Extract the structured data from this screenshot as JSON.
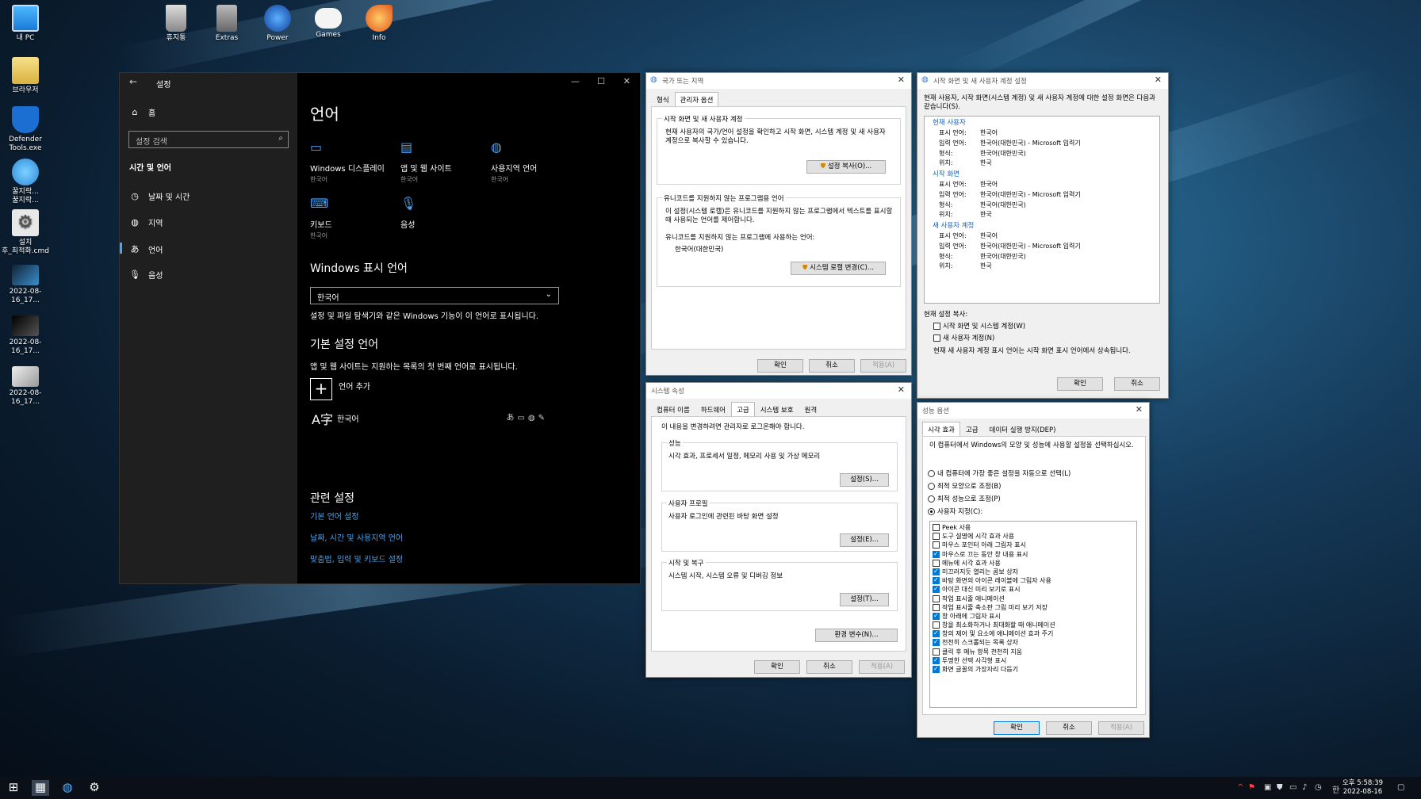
{
  "desktop_icons": [
    {
      "label": "내 PC",
      "icon": "monitor-icon"
    },
    {
      "label": "브라우저",
      "icon": "folder-icon"
    },
    {
      "label": "Defender Tools.exe",
      "icon": "shield-icon"
    },
    {
      "label": "꿀지락...\n꿀지락...",
      "icon": "ie-icon"
    },
    {
      "label": "설치\n후_최적화.cmd",
      "icon": "gear-icon"
    },
    {
      "label": "2022-08-16_17...",
      "icon": "image-icon"
    },
    {
      "label": "2022-08-16_17...",
      "icon": "image-icon"
    },
    {
      "label": "2022-08-16_17...",
      "icon": "image-icon"
    },
    {
      "label": "휴지통",
      "icon": "recycle-bin-icon"
    },
    {
      "label": "Extras",
      "icon": "folder-icon"
    },
    {
      "label": "Power",
      "icon": "power-icon"
    },
    {
      "label": "Games",
      "icon": "gamepad-icon"
    },
    {
      "label": "Info",
      "icon": "info-icon"
    }
  ],
  "settings": {
    "window_title": "설정",
    "home": "홈",
    "search_placeholder": "설정 검색",
    "section": "시간 및 언어",
    "nav": [
      "날짜 및 시간",
      "지역",
      "언어",
      "음성"
    ],
    "page_title": "언어",
    "tiles": [
      {
        "label": "Windows 디스플레이",
        "sub": "한국어"
      },
      {
        "label": "앱 및 웹 사이트",
        "sub": "한국어"
      },
      {
        "label": "사용지역 언어",
        "sub": "한국어"
      },
      {
        "label": "키보드",
        "sub": "한국어"
      },
      {
        "label": "음성",
        "sub": ""
      }
    ],
    "display_lang_heading": "Windows 표시 언어",
    "display_lang_value": "한국어",
    "display_lang_desc": "설정 및 파일 탐색기와 같은 Windows 기능이 이 언어로 표시됩니다.",
    "pref_heading": "기본 설정 언어",
    "pref_desc": "앱 및 웹 사이트는 지원하는 목록의 첫 번째 언어로 표시됩니다.",
    "add_lang": "언어 추가",
    "lang_item": "한국어",
    "related_heading": "관련 설정",
    "related_links": [
      "기본 언어 설정",
      "날짜, 시간 및 사용지역 언어",
      "맞춤법, 입력 및 키보드 설정"
    ]
  },
  "region_dialog": {
    "title": "국가 또는 지역",
    "tabs": [
      "형식",
      "관리자 옵션"
    ],
    "grp1_title": "시작 화면 및 새 사용자 계정",
    "grp1_text": "현재 사용자의 국가/언어 설정을 확인하고 시작 화면, 시스템 계정 및 새 사용자 계정으로 복사할 수 있습니다.",
    "grp1_button": "설정 복사(O)...",
    "grp2_title": "유니코드를 지원하지 않는 프로그램용 언어",
    "grp2_text": "이 설정(시스템 로캘)은 유니코드를 지원하지 않는 프로그램에서 텍스트를 표시할 때 사용되는 언어를 제어합니다.",
    "grp2_label": "유니코드를 지원하지 않는 프로그램에 사용하는 언어:",
    "grp2_value": "한국어(대한민국)",
    "grp2_button": "시스템 로캘 변경(C)...",
    "ok": "확인",
    "cancel": "취소",
    "apply": "적용(A)"
  },
  "welcome_dialog": {
    "title": "시작 화면 및 새 사용자 계정 설정",
    "intro": "현재 사용자, 시작 화면(시스템 계정) 및 새 사용자 계정에 대한 설정 화면은 다음과 같습니다(S).",
    "sections": [
      {
        "name": "현재 사용자",
        "rows": [
          [
            "표시 언어:",
            "한국어"
          ],
          [
            "입력 언어:",
            "한국어(대한민국) - Microsoft 입력기"
          ],
          [
            "형식:",
            "한국어(대한민국)"
          ],
          [
            "위치:",
            "한국"
          ]
        ]
      },
      {
        "name": "시작 화면",
        "rows": [
          [
            "표시 언어:",
            "한국어"
          ],
          [
            "입력 언어:",
            "한국어(대한민국) - Microsoft 입력기"
          ],
          [
            "형식:",
            "한국어(대한민국)"
          ],
          [
            "위치:",
            "한국"
          ]
        ]
      },
      {
        "name": "새 사용자 계정",
        "rows": [
          [
            "표시 언어:",
            "한국어"
          ],
          [
            "입력 언어:",
            "한국어(대한민국) - Microsoft 입력기"
          ],
          [
            "형식:",
            "한국어(대한민국)"
          ],
          [
            "위치:",
            "한국"
          ]
        ]
      }
    ],
    "copy_label": "현재 설정 복사:",
    "check1": "시작 화면 및 시스템 계정(W)",
    "check2": "새 사용자 계정(N)",
    "note": "현재 새 사용자 계정 표시 언어는 시작 화면 표시 언어에서 상속됩니다.",
    "ok": "확인",
    "cancel": "취소"
  },
  "sysprop_dialog": {
    "title": "시스템 속성",
    "tabs": [
      "컴퓨터 이름",
      "하드웨어",
      "고급",
      "시스템 보호",
      "원격"
    ],
    "admin_note": "이 내용을 변경하려면 관리자로 로그온해야 합니다.",
    "perf_title": "성능",
    "perf_text": "시각 효과, 프로세서 일정, 메모리 사용 및 가상 메모리",
    "perf_button": "설정(S)...",
    "profile_title": "사용자 프로필",
    "profile_text": "사용자 로그인에 관련된 바탕 화면 설정",
    "profile_button": "설정(E)...",
    "startup_title": "시작 및 복구",
    "startup_text": "시스템 시작, 시스템 오류 및 디버깅 정보",
    "startup_button": "설정(T)...",
    "env_button": "환경 변수(N)...",
    "ok": "확인",
    "cancel": "취소",
    "apply": "적용(A)"
  },
  "perf_dialog": {
    "title": "성능 옵션",
    "tabs": [
      "시각 효과",
      "고급",
      "데이터 실행 방지(DEP)"
    ],
    "intro": "이 컴퓨터에서 Windows의 모양 및 성능에 사용할 설정을 선택하십시오.",
    "radios": [
      {
        "label": "내 컴퓨터에 가장 좋은 설정을 자동으로 선택(L)",
        "on": false
      },
      {
        "label": "최적 모양으로 조정(B)",
        "on": false
      },
      {
        "label": "최적 성능으로 조정(P)",
        "on": false
      },
      {
        "label": "사용자 지정(C):",
        "on": true
      }
    ],
    "options": [
      {
        "label": "Peek 사용",
        "on": false
      },
      {
        "label": "도구 설명에 시각 효과 사용",
        "on": false
      },
      {
        "label": "마우스 포인터 아래 그림자 표시",
        "on": false
      },
      {
        "label": "마우스로 끄는 동안 창 내용 표시",
        "on": true
      },
      {
        "label": "메뉴에 시각 효과 사용",
        "on": false
      },
      {
        "label": "미끄러지듯 열리는 콤보 상자",
        "on": true
      },
      {
        "label": "바탕 화면의 아이콘 레이블에 그림자 사용",
        "on": true
      },
      {
        "label": "아이콘 대신 미리 보기로 표시",
        "on": true
      },
      {
        "label": "작업 표시줄 애니메이션",
        "on": false
      },
      {
        "label": "작업 표시줄 축소판 그림 미리 보기 저장",
        "on": false
      },
      {
        "label": "창 아래에 그림자 표시",
        "on": true
      },
      {
        "label": "창을 최소화하거나 최대화할 때 애니메이션",
        "on": false
      },
      {
        "label": "창의 제어 및 요소에 애니메이션 효과 주기",
        "on": true
      },
      {
        "label": "천천히 스크롤되는 목록 상자",
        "on": true
      },
      {
        "label": "클릭 후 메뉴 항목 천천히 지움",
        "on": false
      },
      {
        "label": "투명한 선택 사각형 표시",
        "on": true
      },
      {
        "label": "화면 글꼴의 가장자리 다듬기",
        "on": true
      }
    ],
    "ok": "확인",
    "cancel": "취소",
    "apply": "적용(A)"
  },
  "taskbar": {
    "time": "오후 5:58:39",
    "date": "2022-08-16"
  }
}
